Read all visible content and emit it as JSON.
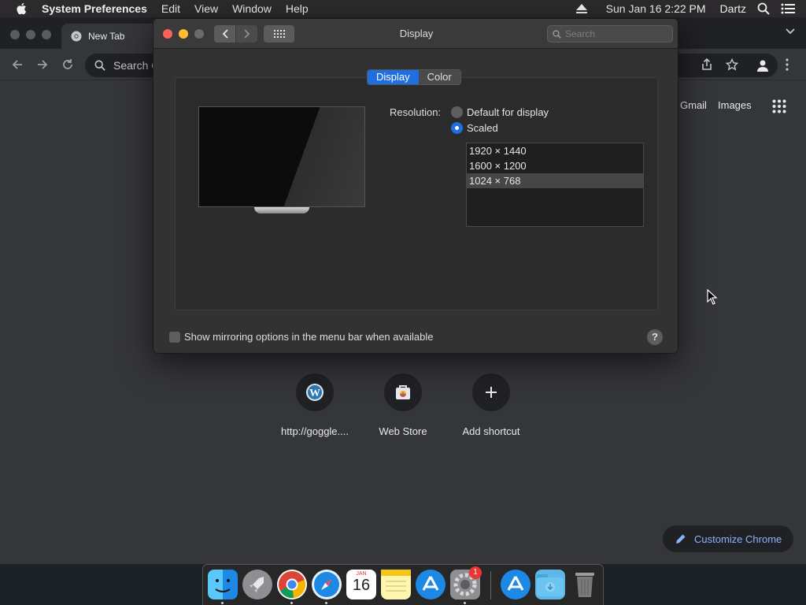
{
  "menubar": {
    "app_name": "System Preferences",
    "menus": [
      "Edit",
      "View",
      "Window",
      "Help"
    ],
    "clock": "Sun Jan 16  2:22 PM",
    "user": "Dartz"
  },
  "chrome": {
    "tab_title": "New Tab",
    "omnibox_placeholder": "Search Google or type a URL",
    "links": {
      "gmail": "Gmail",
      "images": "Images"
    },
    "shortcuts": [
      {
        "label": "http://goggle...."
      },
      {
        "label": "Web Store"
      },
      {
        "label": "Add shortcut"
      }
    ],
    "customize_label": "Customize Chrome"
  },
  "prefs": {
    "title": "Display",
    "search_placeholder": "Search",
    "tabs": [
      "Display",
      "Color"
    ],
    "active_tab": "Display",
    "resolution_label": "Resolution:",
    "options": [
      "Default for display",
      "Scaled"
    ],
    "selected_option": "Scaled",
    "resolutions": [
      "1920 × 1440",
      "1600 × 1200",
      "1024 × 768"
    ],
    "selected_resolution": "1024 × 768",
    "mirror_label": "Show mirroring options in the menu bar when available",
    "help_label": "?"
  },
  "dock": {
    "calendar_day": "16",
    "calendar_month": "JAN",
    "badge_count": "1"
  },
  "colors": {
    "accent": "#1f6fe0",
    "chrome_bg": "#35363a",
    "prefs_bg": "#323232",
    "close": "#fe5f57",
    "minimize": "#febc2e",
    "link_blue": "#8ab4f8"
  }
}
